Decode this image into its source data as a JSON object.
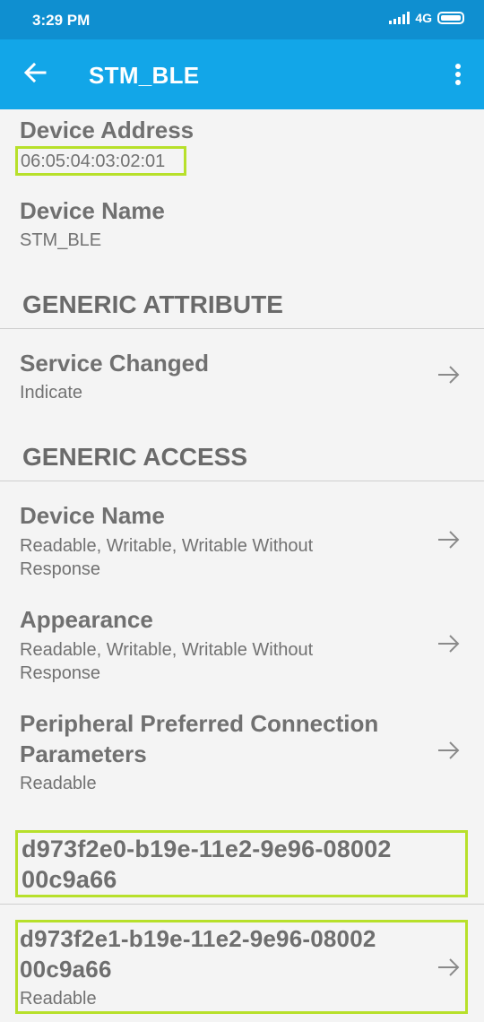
{
  "status_bar": {
    "time": "3:29 PM",
    "network": "4G"
  },
  "app_bar": {
    "title": "STM_BLE",
    "back_icon": "arrow-left-icon",
    "menu_icon": "more-vert-icon"
  },
  "device": {
    "address_label": "Device Address",
    "address_value": "06:05:04:03:02:01",
    "name_label": "Device Name",
    "name_value": "STM_BLE"
  },
  "services": [
    {
      "title": "GENERIC ATTRIBUTE",
      "characteristics": [
        {
          "name": "Service Changed",
          "properties": "Indicate"
        }
      ]
    },
    {
      "title": "GENERIC ACCESS",
      "characteristics": [
        {
          "name": "Device Name",
          "properties_line1": "Readable, Writable, Writable Without",
          "properties_line2": "Response"
        },
        {
          "name": "Appearance",
          "properties_line1": "Readable, Writable, Writable Without",
          "properties_line2": "Response"
        },
        {
          "name_line1": "Peripheral Preferred Connection",
          "name_line2": "Parameters",
          "properties": "Readable"
        }
      ]
    },
    {
      "title_line1": "d973f2e0-b19e-11e2-9e96-08002",
      "title_line2": "00c9a66",
      "characteristics": [
        {
          "name_line1": "d973f2e1-b19e-11e2-9e96-08002",
          "name_line2": "00c9a66",
          "properties": "Readable"
        }
      ]
    }
  ],
  "colors": {
    "status_bar": "#0f8fd0",
    "app_bar": "#12a6e8",
    "highlight": "#b7e02a",
    "background": "#f4f4f4"
  }
}
